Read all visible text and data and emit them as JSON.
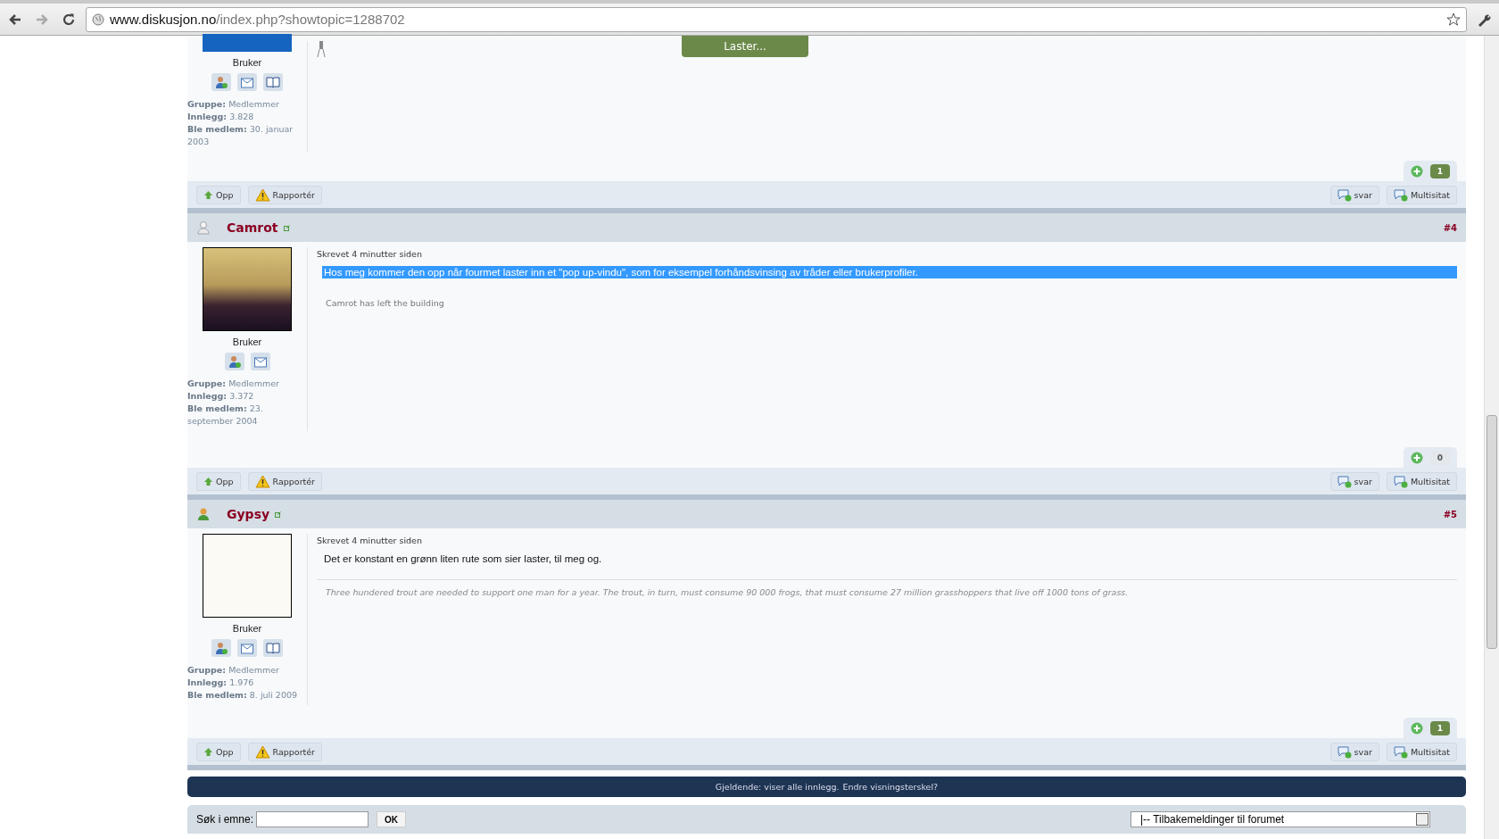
{
  "browser": {
    "url_host": "www.diskusjon.no",
    "url_path": "/index.php?showtopic=1288702"
  },
  "loading_popup": "Laster...",
  "posts": [
    {
      "avatar": {
        "kind": "person"
      },
      "rank": "Bruker",
      "profile_icons": [
        {
          "kind": "add-friend"
        },
        {
          "kind": "message"
        },
        {
          "kind": "blog"
        }
      ],
      "stats": [
        {
          "label": "Gruppe:",
          "value": "Medlemmer"
        },
        {
          "label": "Innlegg:",
          "value": "3.828"
        },
        {
          "label": "Ble medlem:",
          "value": "30. januar 2003"
        }
      ],
      "rating": {
        "count": "1",
        "color": "#6b8a4a"
      },
      "actions": [
        {
          "kind": "up",
          "label": "Opp"
        },
        {
          "kind": "report",
          "label": "Rapportér"
        },
        {
          "kind": "reply",
          "label": "svar"
        },
        {
          "kind": "reply",
          "label": "Multisitat"
        }
      ]
    },
    {
      "author": "Camrot",
      "online": false,
      "post_number": "#4",
      "avatar": {
        "kind": "portrait"
      },
      "rank": "Bruker",
      "profile_icons": [
        {
          "kind": "add-friend"
        },
        {
          "kind": "message"
        }
      ],
      "stats": [
        {
          "label": "Gruppe:",
          "value": "Medlemmer"
        },
        {
          "label": "Innlegg:",
          "value": "3.372"
        },
        {
          "label": "Ble medlem:",
          "value": "23. september 2004"
        }
      ],
      "timestamp": "Skrevet 4 minutter siden",
      "body": {
        "text": "Hos meg kommer den opp når fourmet laster inn et \"pop up-vindu\", som for eksempel forhåndsvinsing av tråder eller brukerprofiler.",
        "selected": true
      },
      "signature": {
        "text": "Camrot has left the building",
        "kind": "plain"
      },
      "rating": {
        "count": "0",
        "color": "#e4e8ec"
      },
      "actions": [
        {
          "kind": "up",
          "label": "Opp"
        },
        {
          "kind": "report",
          "label": "Rapportér"
        },
        {
          "kind": "reply",
          "label": "svar"
        },
        {
          "kind": "reply",
          "label": "Multisitat"
        }
      ]
    },
    {
      "author": "Gypsy",
      "online": true,
      "post_number": "#5",
      "avatar": {
        "kind": "cartoon"
      },
      "rank": "Bruker",
      "profile_icons": [
        {
          "kind": "add-friend"
        },
        {
          "kind": "message"
        },
        {
          "kind": "blog"
        }
      ],
      "stats": [
        {
          "label": "Gruppe:",
          "value": "Medlemmer"
        },
        {
          "label": "Innlegg:",
          "value": "1.976"
        },
        {
          "label": "Ble medlem:",
          "value": "8. juli 2009"
        }
      ],
      "timestamp": "Skrevet 4 minutter siden",
      "body": {
        "text": "Det er konstant en grønn liten rute som sier laster, til meg og.",
        "selected": false
      },
      "signature": {
        "text": "Three hundered trout are needed to support one man for a year. The trout, in turn, must consume 90 000 frogs, that must consume 27 million grasshoppers that live off 1000 tons of grass.",
        "kind": "quote"
      },
      "rating": {
        "count": "1",
        "color": "#6b8a4a"
      },
      "actions": [
        {
          "kind": "up",
          "label": "Opp"
        },
        {
          "kind": "report",
          "label": "Rapportér"
        },
        {
          "kind": "reply",
          "label": "svar"
        },
        {
          "kind": "reply",
          "label": "Multisitat"
        }
      ]
    }
  ],
  "filter_bar": {
    "text": "Gjeldende: viser alle innlegg.",
    "link": "Endre visningsterskel?"
  },
  "topic_search": {
    "label": "Søk i emne:",
    "button": "OK"
  },
  "forum_jump": {
    "value": "|-- Tilbakemeldinger til forumet"
  }
}
